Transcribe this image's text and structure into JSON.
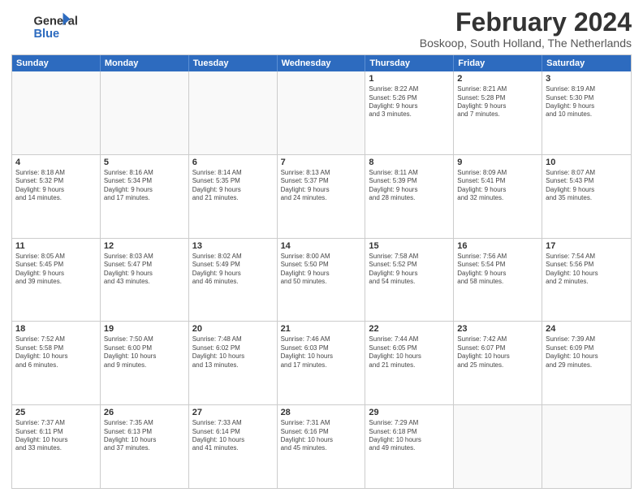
{
  "logo": {
    "line1": "General",
    "line2": "Blue"
  },
  "title": "February 2024",
  "location": "Boskoop, South Holland, The Netherlands",
  "weekdays": [
    "Sunday",
    "Monday",
    "Tuesday",
    "Wednesday",
    "Thursday",
    "Friday",
    "Saturday"
  ],
  "rows": [
    [
      {
        "day": "",
        "text": ""
      },
      {
        "day": "",
        "text": ""
      },
      {
        "day": "",
        "text": ""
      },
      {
        "day": "",
        "text": ""
      },
      {
        "day": "1",
        "text": "Sunrise: 8:22 AM\nSunset: 5:26 PM\nDaylight: 9 hours\nand 3 minutes."
      },
      {
        "day": "2",
        "text": "Sunrise: 8:21 AM\nSunset: 5:28 PM\nDaylight: 9 hours\nand 7 minutes."
      },
      {
        "day": "3",
        "text": "Sunrise: 8:19 AM\nSunset: 5:30 PM\nDaylight: 9 hours\nand 10 minutes."
      }
    ],
    [
      {
        "day": "4",
        "text": "Sunrise: 8:18 AM\nSunset: 5:32 PM\nDaylight: 9 hours\nand 14 minutes."
      },
      {
        "day": "5",
        "text": "Sunrise: 8:16 AM\nSunset: 5:34 PM\nDaylight: 9 hours\nand 17 minutes."
      },
      {
        "day": "6",
        "text": "Sunrise: 8:14 AM\nSunset: 5:35 PM\nDaylight: 9 hours\nand 21 minutes."
      },
      {
        "day": "7",
        "text": "Sunrise: 8:13 AM\nSunset: 5:37 PM\nDaylight: 9 hours\nand 24 minutes."
      },
      {
        "day": "8",
        "text": "Sunrise: 8:11 AM\nSunset: 5:39 PM\nDaylight: 9 hours\nand 28 minutes."
      },
      {
        "day": "9",
        "text": "Sunrise: 8:09 AM\nSunset: 5:41 PM\nDaylight: 9 hours\nand 32 minutes."
      },
      {
        "day": "10",
        "text": "Sunrise: 8:07 AM\nSunset: 5:43 PM\nDaylight: 9 hours\nand 35 minutes."
      }
    ],
    [
      {
        "day": "11",
        "text": "Sunrise: 8:05 AM\nSunset: 5:45 PM\nDaylight: 9 hours\nand 39 minutes."
      },
      {
        "day": "12",
        "text": "Sunrise: 8:03 AM\nSunset: 5:47 PM\nDaylight: 9 hours\nand 43 minutes."
      },
      {
        "day": "13",
        "text": "Sunrise: 8:02 AM\nSunset: 5:49 PM\nDaylight: 9 hours\nand 46 minutes."
      },
      {
        "day": "14",
        "text": "Sunrise: 8:00 AM\nSunset: 5:50 PM\nDaylight: 9 hours\nand 50 minutes."
      },
      {
        "day": "15",
        "text": "Sunrise: 7:58 AM\nSunset: 5:52 PM\nDaylight: 9 hours\nand 54 minutes."
      },
      {
        "day": "16",
        "text": "Sunrise: 7:56 AM\nSunset: 5:54 PM\nDaylight: 9 hours\nand 58 minutes."
      },
      {
        "day": "17",
        "text": "Sunrise: 7:54 AM\nSunset: 5:56 PM\nDaylight: 10 hours\nand 2 minutes."
      }
    ],
    [
      {
        "day": "18",
        "text": "Sunrise: 7:52 AM\nSunset: 5:58 PM\nDaylight: 10 hours\nand 6 minutes."
      },
      {
        "day": "19",
        "text": "Sunrise: 7:50 AM\nSunset: 6:00 PM\nDaylight: 10 hours\nand 9 minutes."
      },
      {
        "day": "20",
        "text": "Sunrise: 7:48 AM\nSunset: 6:02 PM\nDaylight: 10 hours\nand 13 minutes."
      },
      {
        "day": "21",
        "text": "Sunrise: 7:46 AM\nSunset: 6:03 PM\nDaylight: 10 hours\nand 17 minutes."
      },
      {
        "day": "22",
        "text": "Sunrise: 7:44 AM\nSunset: 6:05 PM\nDaylight: 10 hours\nand 21 minutes."
      },
      {
        "day": "23",
        "text": "Sunrise: 7:42 AM\nSunset: 6:07 PM\nDaylight: 10 hours\nand 25 minutes."
      },
      {
        "day": "24",
        "text": "Sunrise: 7:39 AM\nSunset: 6:09 PM\nDaylight: 10 hours\nand 29 minutes."
      }
    ],
    [
      {
        "day": "25",
        "text": "Sunrise: 7:37 AM\nSunset: 6:11 PM\nDaylight: 10 hours\nand 33 minutes."
      },
      {
        "day": "26",
        "text": "Sunrise: 7:35 AM\nSunset: 6:13 PM\nDaylight: 10 hours\nand 37 minutes."
      },
      {
        "day": "27",
        "text": "Sunrise: 7:33 AM\nSunset: 6:14 PM\nDaylight: 10 hours\nand 41 minutes."
      },
      {
        "day": "28",
        "text": "Sunrise: 7:31 AM\nSunset: 6:16 PM\nDaylight: 10 hours\nand 45 minutes."
      },
      {
        "day": "29",
        "text": "Sunrise: 7:29 AM\nSunset: 6:18 PM\nDaylight: 10 hours\nand 49 minutes."
      },
      {
        "day": "",
        "text": ""
      },
      {
        "day": "",
        "text": ""
      }
    ]
  ]
}
